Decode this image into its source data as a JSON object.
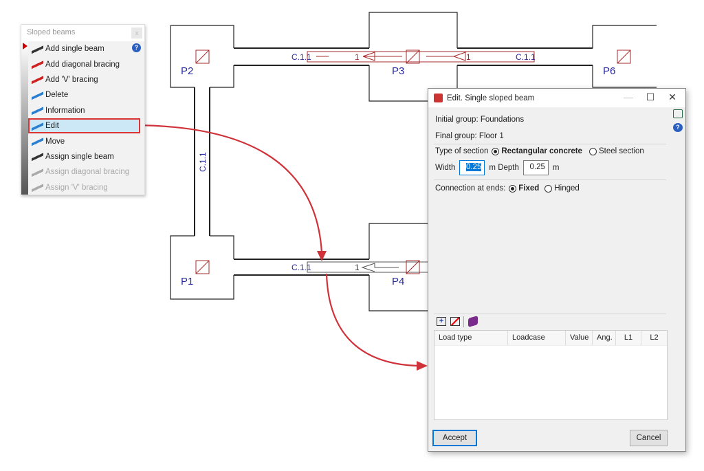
{
  "drawing": {
    "columns": [
      "P1",
      "P2",
      "P3",
      "P4",
      "P6"
    ],
    "beam_label": "C.1.1",
    "beam_number": "1",
    "vertical_beam_label": "C.1.1"
  },
  "menu": {
    "title": "Sloped beams",
    "close": "x",
    "help": "?",
    "items": [
      {
        "label": "Add single beam",
        "icon": "add-single-beam-icon",
        "enabled": true
      },
      {
        "label": "Add diagonal bracing",
        "icon": "add-diagonal-bracing-icon",
        "enabled": true
      },
      {
        "label": "Add 'V' bracing",
        "icon": "add-v-bracing-icon",
        "enabled": true
      },
      {
        "label": "Delete",
        "icon": "delete-beam-icon",
        "enabled": true
      },
      {
        "label": "Information",
        "icon": "information-icon",
        "enabled": true
      },
      {
        "label": "Edit",
        "icon": "edit-pencil-icon",
        "enabled": true,
        "selected": true
      },
      {
        "label": "Move",
        "icon": "move-icon",
        "enabled": true
      },
      {
        "label": "Assign single beam",
        "icon": "assign-beam-icon",
        "enabled": true
      },
      {
        "label": "Assign diagonal bracing",
        "icon": "assign-diagonal-icon",
        "enabled": false
      },
      {
        "label": "Assign 'V' bracing",
        "icon": "assign-v-icon",
        "enabled": false
      }
    ]
  },
  "dialog": {
    "title": "Edit. Single sloped beam",
    "initial_group": "Initial group: Foundations",
    "final_group": "Final group: Floor 1",
    "type_label": "Type of section",
    "type_options": [
      "Rectangular concrete",
      "Steel section"
    ],
    "type_selected": "Rectangular concrete",
    "width_label": "Width",
    "width_value": "0.25",
    "unit": "m",
    "depth_label": "Depth",
    "depth_value": "0.25",
    "connection_label": "Connection at ends:",
    "connection_options": [
      "Fixed",
      "Hinged"
    ],
    "connection_selected": "Fixed",
    "table_columns": [
      "Load type",
      "Loadcase",
      "Value",
      "Ang.",
      "L1",
      "L2"
    ],
    "table_rows": [],
    "accept": "Accept",
    "cancel": "Cancel",
    "accent": "#0078d7"
  },
  "colors": {
    "annotation_arrow": "#d0323a",
    "beam_red": "#a52a2a",
    "label_blue": "#2a2aa0"
  }
}
